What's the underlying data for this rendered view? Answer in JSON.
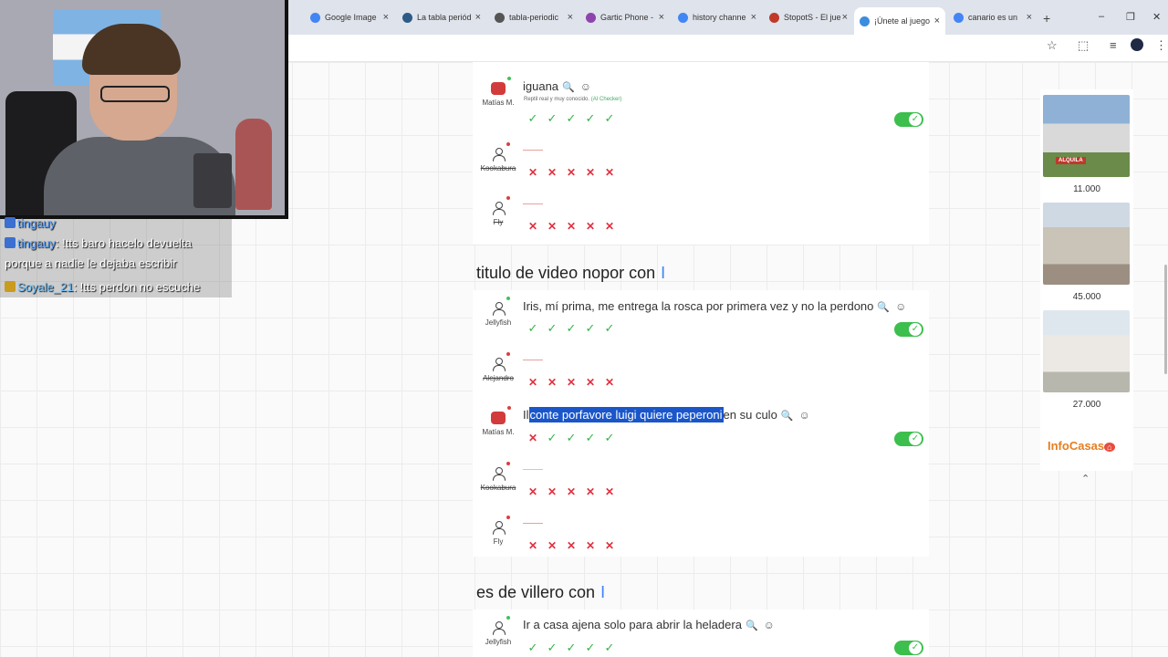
{
  "browser": {
    "tabs": [
      {
        "label": "Google Image",
        "color": "#4285f4"
      },
      {
        "label": "La tabla periód",
        "color": "#2e5a87"
      },
      {
        "label": "tabla-periodic",
        "color": "#555555"
      },
      {
        "label": "Gartic Phone -",
        "color": "#8e44ad"
      },
      {
        "label": "history channe",
        "color": "#4285f4"
      },
      {
        "label": "StopotS - El jue",
        "color": "#c0392b"
      },
      {
        "label": "¡Únete al juego",
        "color": "#3c8dde"
      },
      {
        "label": "canario es un",
        "color": "#4285f4"
      }
    ],
    "tab_close": "×",
    "new_tab": "+",
    "window_controls": [
      "–",
      "❐",
      "✕"
    ],
    "toolbar_icons": [
      "star-icon",
      "extensions-icon",
      "media-icon",
      "menu-icon"
    ]
  },
  "stream": {
    "chat": [
      {
        "user": "tingauy",
        "message": ""
      },
      {
        "user": "tingauy",
        "message": ": !tts baro hacelo devuelta"
      },
      {
        "user": "",
        "message": "porque a nadie le dejaba escribir"
      },
      {
        "user": "Soyale_21",
        "message": ": !tts perdon no escuche"
      }
    ]
  },
  "game": {
    "round1": {
      "players": [
        {
          "name": "Matías M.",
          "answer": "iguana",
          "sub": "Reptil real y muy conocido.",
          "checker": "(AI Checker)",
          "votes": "valid"
        },
        {
          "name": "Kookabura",
          "answer": "",
          "votes": "invalid"
        },
        {
          "name": "Fly",
          "answer": "",
          "votes": "invalid"
        }
      ]
    },
    "round2": {
      "title": "titulo de video nopor con",
      "cursor": "I",
      "players": [
        {
          "name": "Jellyfish",
          "answer": "Iris, mí prima, me entrega la rosca por primera vez y no la perdono"
        },
        {
          "name": "Alejandro",
          "answer": ""
        },
        {
          "name": "Matías M.",
          "answer_before": "Il",
          "answer_selected": "conte porfavore luigi quiere peperoni",
          "answer_after": "en su culo"
        },
        {
          "name": "Kookabura",
          "answer": ""
        },
        {
          "name": "Fly",
          "answer": ""
        }
      ]
    },
    "round3": {
      "title": "es de villero con",
      "cursor": "I",
      "players": [
        {
          "name": "Jellyfish",
          "answer": "Ir a casa ajena solo para abrir la heladera"
        }
      ]
    },
    "icons": {
      "search": "🔍",
      "emoji": "☺",
      "check": "✓",
      "cross": "✕"
    }
  },
  "ad": {
    "banner_text": "ALQUILA",
    "prices": [
      "11.000",
      "45.000",
      "27.000"
    ],
    "brand": "InfoCasas",
    "colors": {
      "brand": "#e67e22"
    }
  }
}
